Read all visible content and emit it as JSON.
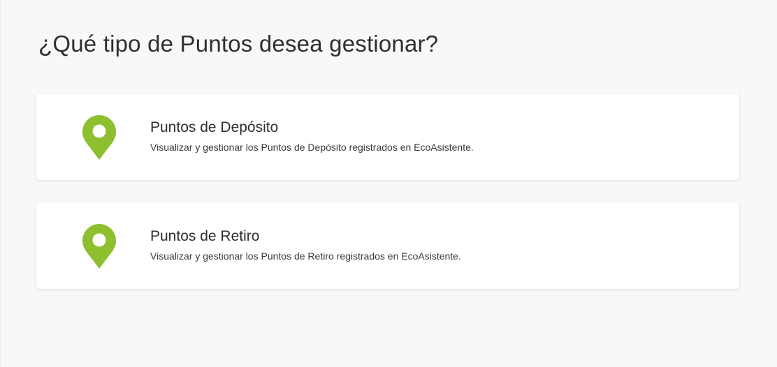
{
  "page": {
    "title": "¿Qué tipo de Puntos desea gestionar?"
  },
  "options": [
    {
      "title": "Puntos de Depósito",
      "description": "Visualizar y gestionar los Puntos de Depósito registrados en EcoAsistente.",
      "icon": "map-pin-icon"
    },
    {
      "title": "Puntos de Retiro",
      "description": "Visualizar y gestionar los Puntos de Retiro registrados en EcoAsistente.",
      "icon": "map-pin-icon"
    }
  ],
  "colors": {
    "accent": "#8dbf2e",
    "background": "#f7f8fa",
    "card": "#ffffff"
  }
}
